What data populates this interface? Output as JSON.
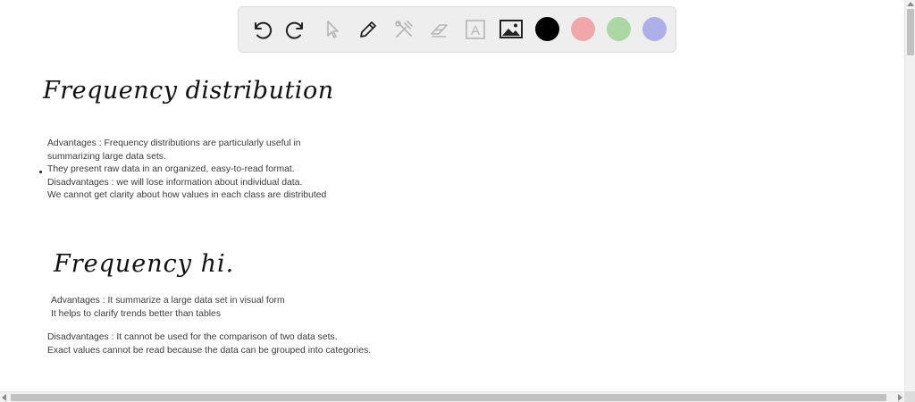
{
  "toolbar": {
    "tools": [
      {
        "icon": "undo-icon"
      },
      {
        "icon": "redo-icon"
      },
      {
        "icon": "select-pointer-icon"
      },
      {
        "icon": "pen-icon"
      },
      {
        "icon": "tools-icon"
      },
      {
        "icon": "eraser-icon"
      },
      {
        "icon": "text-box-icon",
        "glyph": "A"
      },
      {
        "icon": "image-icon"
      }
    ],
    "colors": [
      "#000000",
      "#f0a7aa",
      "#aad7a4",
      "#aeaee9"
    ]
  },
  "notes": {
    "section1": {
      "heading": "Frequency distribution",
      "lines": [
        "Advantages : Frequency distributions are particularly useful in",
        "summarizing large data sets.",
        "They present raw data in an organized, easy-to-read format.",
        "Disadvantages : we will lose information about individual data.",
        "We cannot get clarity about how values in each class are distributed"
      ]
    },
    "section2": {
      "heading": "Frequency hi.",
      "advantages": [
        "Advantages : It summarize a large data set in visual form",
        "It helps to clarify trends better than tables"
      ],
      "disadvantages": [
        "Disadvantages : It cannot be used for the comparison of two data sets.",
        "Exact values cannot be read because the data can be grouped into categories."
      ]
    }
  }
}
